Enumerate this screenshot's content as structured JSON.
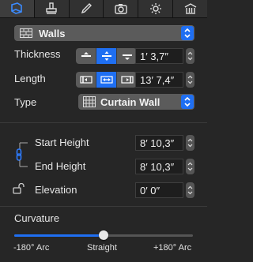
{
  "tabs": [
    {
      "icon": "wall-tool-icon",
      "active": true
    },
    {
      "icon": "stamp-icon",
      "active": false
    },
    {
      "icon": "pencil-icon",
      "active": false
    },
    {
      "icon": "camera-icon",
      "active": false
    },
    {
      "icon": "sun-icon",
      "active": false
    },
    {
      "icon": "building-icon",
      "active": false
    }
  ],
  "selector": {
    "label": "Walls",
    "icon": "brick-wall-icon"
  },
  "thickness": {
    "label": "Thickness",
    "value": "1′ 3,7″",
    "selected_index": 1
  },
  "length": {
    "label": "Length",
    "value": "13′ 7,4″",
    "selected_index": 1
  },
  "type": {
    "label": "Type",
    "value": "Curtain Wall",
    "icon": "grid-icon"
  },
  "start_height": {
    "label": "Start Height",
    "value": "8′ 10,3″"
  },
  "end_height": {
    "label": "End Height",
    "value": "8′ 10,3″"
  },
  "elevation": {
    "label": "Elevation",
    "value": "0′ 0″"
  },
  "curvature": {
    "label": "Curvature",
    "min_label": "-180° Arc",
    "mid_label": "Straight",
    "max_label": "+180° Arc",
    "min": -180,
    "max": 180,
    "value": 0
  },
  "colors": {
    "accent": "#1f6ff2",
    "background": "#262626"
  }
}
